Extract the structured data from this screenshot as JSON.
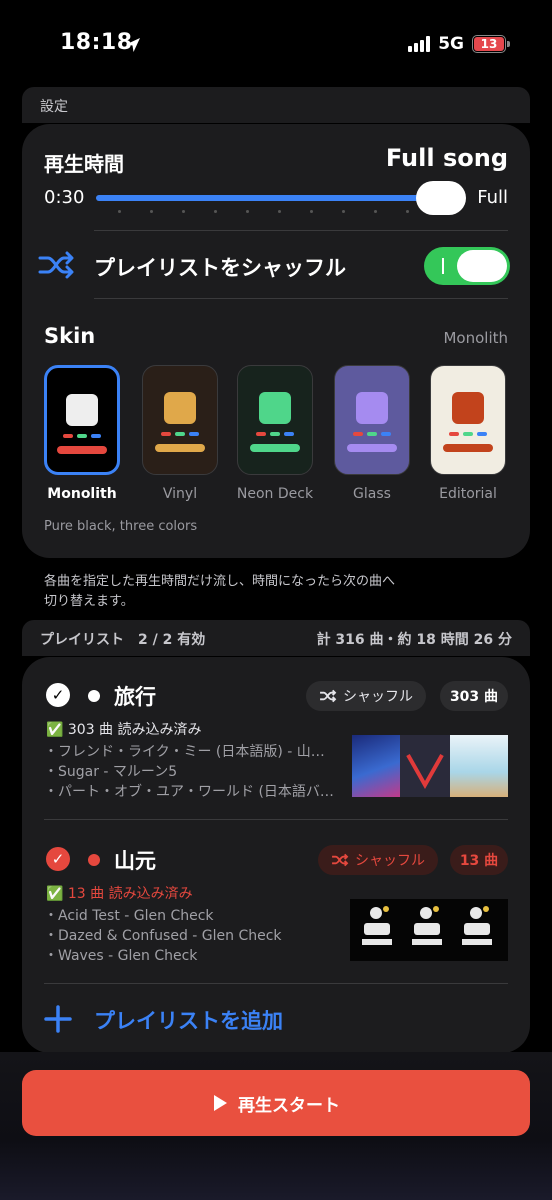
{
  "status_bar": {
    "time": "18:18",
    "network": "5G",
    "battery": "13"
  },
  "settings": {
    "section_label": "設定",
    "duration": {
      "title": "再生時間",
      "value_label": "Full song",
      "min_label": "0:30",
      "max_label": "Full",
      "value_fraction": 1.0
    },
    "shuffle": {
      "label": "プレイリストをシャッフル",
      "enabled": true
    },
    "skin": {
      "title": "Skin",
      "current": "Monolith",
      "description": "Pure black, three colors",
      "options": [
        {
          "name": "Monolith",
          "selected": true,
          "bg": "#000000",
          "accent": "#eeeeee",
          "bar": "#e5483e"
        },
        {
          "name": "Vinyl",
          "selected": false,
          "bg": "#2a1f18",
          "accent": "#e0a84a",
          "bar": "#e0a84a"
        },
        {
          "name": "Neon Deck",
          "selected": false,
          "bg": "#17231d",
          "accent": "#4fd68a",
          "bar": "#4fd68a"
        },
        {
          "name": "Glass",
          "selected": false,
          "bg": "#5e5a9e",
          "accent": "#a58bf0",
          "bar": "#a58bf0"
        },
        {
          "name": "Editorial",
          "selected": false,
          "bg": "#f1ede2",
          "accent": "#c2431c",
          "bar": "#c2431c"
        }
      ]
    },
    "footnote_line1": "各曲を指定した再生時間だけ流し、時間になったら次の曲へ",
    "footnote_line2": "切り替えます。"
  },
  "playlists": {
    "section_label": "プレイリスト　2 / 2 有効",
    "summary": "計 316 曲・約 18 時間 26 分",
    "items": [
      {
        "name": "旅行",
        "shuffle_label": "シャッフル",
        "count_label": "303 曲",
        "status": "✅ 303 曲 読み込み済み",
        "tracks": [
          "・フレンド・ライク・ミー (日本語版) - 山…",
          "・Sugar - マルーン5",
          "・パート・オブ・ユア・ワールド (日本語バ…"
        ]
      },
      {
        "name": "山元",
        "shuffle_label": "シャッフル",
        "count_label": "13 曲",
        "status": "✅ 13 曲 読み込み済み",
        "tracks": [
          "・Acid Test - Glen Check",
          "・Dazed & Confused - Glen Check",
          "・Waves - Glen Check"
        ]
      }
    ],
    "add_label": "プレイリストを追加"
  },
  "play_button": {
    "label": "再生スタート"
  },
  "colors": {
    "accent_blue": "#3b82f6",
    "toggle_green": "#34c759",
    "play_red": "#e9503f"
  }
}
